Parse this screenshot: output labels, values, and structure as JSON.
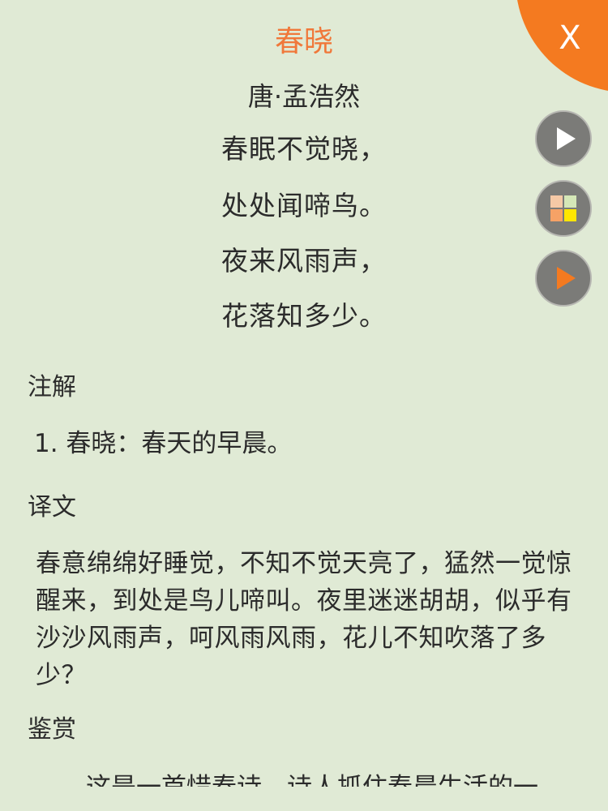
{
  "poem": {
    "title": "春晓",
    "author": "唐·孟浩然",
    "lines": [
      "春眠不觉晓，",
      "处处闻啼鸟。",
      "夜来风雨声，",
      "花落知多少。"
    ]
  },
  "sections": {
    "notes": {
      "heading": "注解",
      "items": [
        "1. 春晓：春天的早晨。"
      ]
    },
    "translation": {
      "heading": "译文",
      "text": "春意绵绵好睡觉，不知不觉天亮了，猛然一觉惊醒来，到处是鸟儿啼叫。夜里迷迷胡胡，似乎有沙沙风雨声，呵风雨风雨，花儿不知吹落了多少？"
    },
    "appreciation": {
      "heading": "鉴赏",
      "text_start": "这是一首惜春诗，诗人抓住春晨生活的一"
    }
  },
  "controls": {
    "close_label": "X",
    "play_icon": "play-icon",
    "grid_icon": "grid-icon",
    "play_orange_icon": "play-orange-icon"
  },
  "colors": {
    "background": "#e0ead5",
    "title": "#f0783a",
    "close_button": "#f47a20",
    "fab": "#7b7b78"
  }
}
